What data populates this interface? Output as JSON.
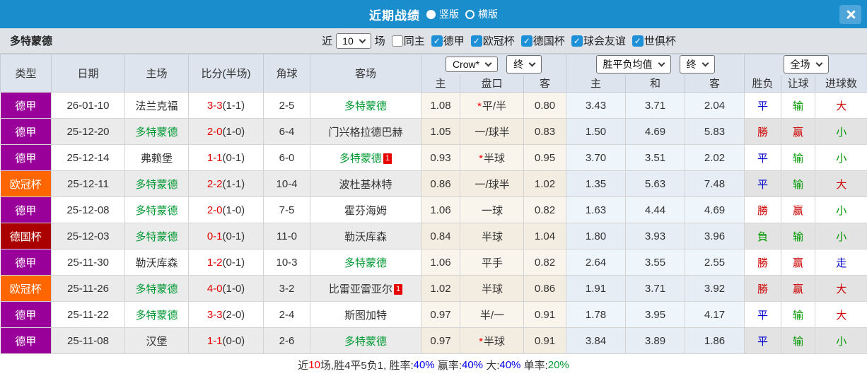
{
  "titlebar": {
    "title": "近期战绩",
    "portrait_label": "竖版",
    "landscape_label": "横版"
  },
  "filterbar": {
    "team": "多特蒙德",
    "near_label": "近",
    "matches_value": "10",
    "matches_label": "场",
    "same_home_label": "同主",
    "same_home_checked": false,
    "check_glyph": "✓",
    "competitions": [
      {
        "label": "德甲",
        "checked": true
      },
      {
        "label": "欧冠杯",
        "checked": true
      },
      {
        "label": "德国杯",
        "checked": true
      },
      {
        "label": "球会友谊",
        "checked": true
      },
      {
        "label": "世俱杯",
        "checked": true
      }
    ]
  },
  "table": {
    "dropdowns": {
      "odds_company": "Crow*",
      "odds_state": "终",
      "avg_label": "胜平负均值",
      "avg_state": "终",
      "scope": "全场"
    },
    "columns": [
      "类型",
      "日期",
      "主场",
      "比分(半场)",
      "角球",
      "客场"
    ],
    "sub_columns": [
      "主",
      "盘口",
      "客",
      "主",
      "和",
      "客",
      "胜负",
      "让球",
      "进球数"
    ],
    "league_colors": {
      "德甲": "#990099",
      "欧冠杯": "#ff6600",
      "德国杯": "#aa0000"
    },
    "result_colors": {
      "平": "#0000cc",
      "勝": "#cc0000",
      "負": "#009900",
      "输": "#009900",
      "赢": "#cc0000",
      "大": "#cc0000",
      "小": "#009900",
      "走": "#0000cc"
    },
    "focus_team": "多特蒙德",
    "rows": [
      {
        "league": "德甲",
        "date": "26-01-10",
        "home": "法兰克福",
        "home_focus": false,
        "home_card": "",
        "score": "3-3",
        "half": "(1-1)",
        "corners": "2-5",
        "away": "多特蒙德",
        "away_focus": true,
        "away_card": "",
        "odds_home": "1.08",
        "handicap_star": true,
        "handicap": "平/半",
        "odds_away": "0.80",
        "avg_win": "3.43",
        "avg_draw": "3.71",
        "avg_lose": "2.04",
        "result_wdl": "平",
        "result_handicap": "输",
        "result_goals": "大"
      },
      {
        "league": "德甲",
        "date": "25-12-20",
        "home": "多特蒙德",
        "home_focus": true,
        "home_card": "",
        "score": "2-0",
        "half": "(1-0)",
        "corners": "6-4",
        "away": "门兴格拉德巴赫",
        "away_focus": false,
        "away_card": "",
        "odds_home": "1.05",
        "handicap_star": false,
        "handicap": "一/球半",
        "odds_away": "0.83",
        "avg_win": "1.50",
        "avg_draw": "4.69",
        "avg_lose": "5.83",
        "result_wdl": "勝",
        "result_handicap": "赢",
        "result_goals": "小"
      },
      {
        "league": "德甲",
        "date": "25-12-14",
        "home": "弗赖堡",
        "home_focus": false,
        "home_card": "",
        "score": "1-1",
        "half": "(0-1)",
        "corners": "6-0",
        "away": "多特蒙德",
        "away_focus": true,
        "away_card": "1",
        "odds_home": "0.93",
        "handicap_star": true,
        "handicap": "半球",
        "odds_away": "0.95",
        "avg_win": "3.70",
        "avg_draw": "3.51",
        "avg_lose": "2.02",
        "result_wdl": "平",
        "result_handicap": "输",
        "result_goals": "小"
      },
      {
        "league": "欧冠杯",
        "date": "25-12-11",
        "home": "多特蒙德",
        "home_focus": true,
        "home_card": "",
        "score": "2-2",
        "half": "(1-1)",
        "corners": "10-4",
        "away": "波杜基林特",
        "away_focus": false,
        "away_card": "",
        "odds_home": "0.86",
        "handicap_star": false,
        "handicap": "一/球半",
        "odds_away": "1.02",
        "avg_win": "1.35",
        "avg_draw": "5.63",
        "avg_lose": "7.48",
        "result_wdl": "平",
        "result_handicap": "输",
        "result_goals": "大"
      },
      {
        "league": "德甲",
        "date": "25-12-08",
        "home": "多特蒙德",
        "home_focus": true,
        "home_card": "",
        "score": "2-0",
        "half": "(1-0)",
        "corners": "7-5",
        "away": "霍芬海姆",
        "away_focus": false,
        "away_card": "",
        "odds_home": "1.06",
        "handicap_star": false,
        "handicap": "一球",
        "odds_away": "0.82",
        "avg_win": "1.63",
        "avg_draw": "4.44",
        "avg_lose": "4.69",
        "result_wdl": "勝",
        "result_handicap": "赢",
        "result_goals": "小"
      },
      {
        "league": "德国杯",
        "date": "25-12-03",
        "home": "多特蒙德",
        "home_focus": true,
        "home_card": "",
        "score": "0-1",
        "half": "(0-1)",
        "corners": "11-0",
        "away": "勒沃库森",
        "away_focus": false,
        "away_card": "",
        "odds_home": "0.84",
        "handicap_star": false,
        "handicap": "半球",
        "odds_away": "1.04",
        "avg_win": "1.80",
        "avg_draw": "3.93",
        "avg_lose": "3.96",
        "result_wdl": "負",
        "result_handicap": "输",
        "result_goals": "小"
      },
      {
        "league": "德甲",
        "date": "25-11-30",
        "home": "勒沃库森",
        "home_focus": false,
        "home_card": "",
        "score": "1-2",
        "half": "(0-1)",
        "corners": "10-3",
        "away": "多特蒙德",
        "away_focus": true,
        "away_card": "",
        "odds_home": "1.06",
        "handicap_star": false,
        "handicap": "平手",
        "odds_away": "0.82",
        "avg_win": "2.64",
        "avg_draw": "3.55",
        "avg_lose": "2.55",
        "result_wdl": "勝",
        "result_handicap": "赢",
        "result_goals": "走"
      },
      {
        "league": "欧冠杯",
        "date": "25-11-26",
        "home": "多特蒙德",
        "home_focus": true,
        "home_card": "",
        "score": "4-0",
        "half": "(1-0)",
        "corners": "3-2",
        "away": "比雷亚雷亚尔",
        "away_focus": false,
        "away_card": "1",
        "odds_home": "1.02",
        "handicap_star": false,
        "handicap": "半球",
        "odds_away": "0.86",
        "avg_win": "1.91",
        "avg_draw": "3.71",
        "avg_lose": "3.92",
        "result_wdl": "勝",
        "result_handicap": "赢",
        "result_goals": "大"
      },
      {
        "league": "德甲",
        "date": "25-11-22",
        "home": "多特蒙德",
        "home_focus": true,
        "home_card": "",
        "score": "3-3",
        "half": "(2-0)",
        "corners": "2-4",
        "away": "斯图加特",
        "away_focus": false,
        "away_card": "",
        "odds_home": "0.97",
        "handicap_star": false,
        "handicap": "半/一",
        "odds_away": "0.91",
        "avg_win": "1.78",
        "avg_draw": "3.95",
        "avg_lose": "4.17",
        "result_wdl": "平",
        "result_handicap": "输",
        "result_goals": "大"
      },
      {
        "league": "德甲",
        "date": "25-11-08",
        "home": "汉堡",
        "home_focus": false,
        "home_card": "",
        "score": "1-1",
        "half": "(0-0)",
        "corners": "2-6",
        "away": "多特蒙德",
        "away_focus": true,
        "away_card": "",
        "odds_home": "0.97",
        "handicap_star": true,
        "handicap": "半球",
        "odds_away": "0.91",
        "avg_win": "3.84",
        "avg_draw": "3.89",
        "avg_lose": "1.86",
        "result_wdl": "平",
        "result_handicap": "输",
        "result_goals": "小"
      }
    ]
  },
  "footer": {
    "segments": [
      {
        "text": "近",
        "color": "#333333"
      },
      {
        "text": "10",
        "color": "#ff0000"
      },
      {
        "text": "场,胜4平5负1, 胜率:",
        "color": "#333333"
      },
      {
        "text": "40%",
        "color": "#0000ee"
      },
      {
        "text": " 赢率:",
        "color": "#333333"
      },
      {
        "text": "40%",
        "color": "#0000ee"
      },
      {
        "text": " 大:",
        "color": "#333333"
      },
      {
        "text": "40%",
        "color": "#0000ee"
      },
      {
        "text": " 单率:",
        "color": "#333333"
      },
      {
        "text": "20%",
        "color": "#009933"
      }
    ]
  }
}
